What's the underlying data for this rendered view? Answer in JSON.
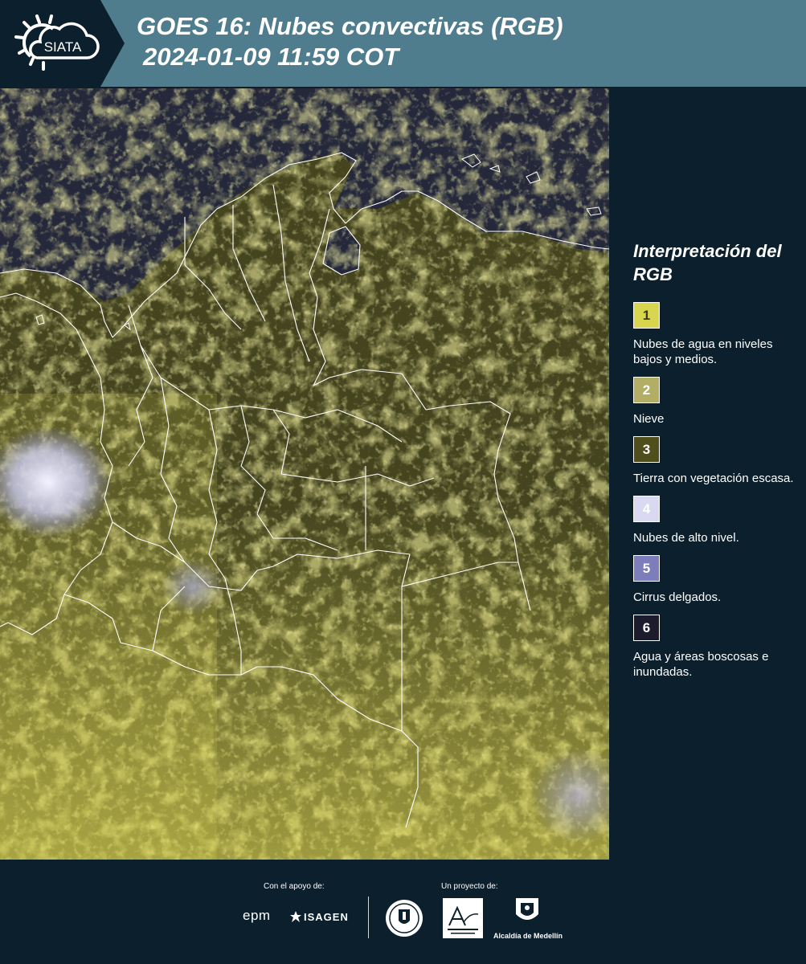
{
  "header": {
    "logo_text": "SIATA",
    "title_line1": "GOES 16: Nubes convectivas (RGB)",
    "title_line2": "2024-01-09 11:59 COT"
  },
  "legend": {
    "title": "Interpretación del RGB",
    "items": [
      {
        "number": "1",
        "label": "Nubes de agua en niveles bajos y medios.",
        "color": "#d8d54e",
        "text_color": "#3a3a1a"
      },
      {
        "number": "2",
        "label": "Nieve",
        "color": "#b3ae66",
        "text_color": "#ffffff"
      },
      {
        "number": "3",
        "label": "Tierra con vegetación escasa.",
        "color": "#4f4f1e",
        "text_color": "#ffffff"
      },
      {
        "number": "4",
        "label": "Nubes de alto nivel.",
        "color": "#d9d9f2",
        "text_color": "#ffffff"
      },
      {
        "number": "5",
        "label": "Cirrus delgados.",
        "color": "#7d7dbb",
        "text_color": "#ffffff"
      },
      {
        "number": "6",
        "label": "Agua y áreas boscosas e inundadas.",
        "color": "#1c1c2c",
        "text_color": "#ffffff"
      }
    ]
  },
  "footer": {
    "support_caption": "Con el apoyo de:",
    "project_caption": "Un proyecto de:",
    "epm": "epm",
    "isagen": "ISAGEN",
    "alcaldia": "Alcaldía de Medellín"
  },
  "colors": {
    "header_band": "#4f7d8d",
    "background": "#0b1f2c",
    "cloud_yellow": "#e6e05a",
    "land_olive": "#4a4a22",
    "water": "#25283a"
  }
}
